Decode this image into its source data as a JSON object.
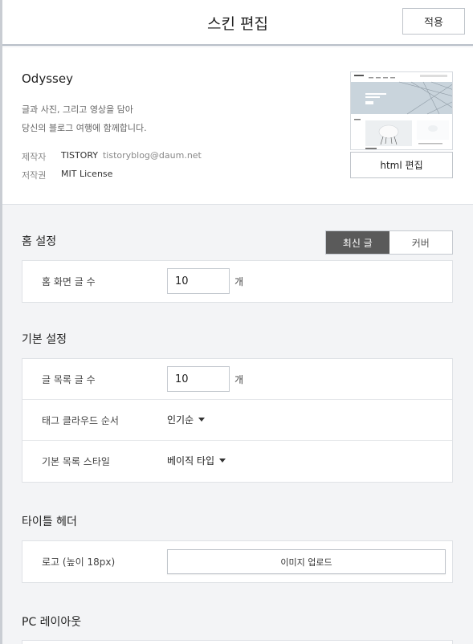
{
  "header": {
    "title": "스킨 편집",
    "apply_label": "적용"
  },
  "skin": {
    "name": "Odyssey",
    "description_line1": "글과 사진, 그리고 영상을 담아",
    "description_line2": "당신의 블로그 여행에 함께합니다.",
    "author_label": "제작자",
    "author_name": "TISTORY",
    "author_email": "tistoryblog@daum.net",
    "license_label": "저작권",
    "license_value": "MIT License",
    "html_edit_label": "html 편집"
  },
  "home_settings": {
    "title": "홈 설정",
    "toggle_options": [
      "최신 글",
      "커버"
    ],
    "active_option": "최신 글",
    "post_count_label": "홈 화면 글 수",
    "post_count_value": "10",
    "unit": "개"
  },
  "basic_settings": {
    "title": "기본 설정",
    "list_count_label": "글 목록 글 수",
    "list_count_value": "10",
    "unit": "개",
    "tag_order_label": "태그 클라우드 순서",
    "tag_order_value": "인기순",
    "list_style_label": "기본 목록 스타일",
    "list_style_value": "베이직 타입"
  },
  "title_header": {
    "title": "타이틀 헤더",
    "logo_label": "로고 (높이 18px)",
    "upload_label": "이미지 업로드"
  },
  "pc_layout": {
    "title": "PC 레이아웃"
  },
  "colors": {
    "active_toggle": "#5a5a5a",
    "check_mark": "#e02020"
  }
}
